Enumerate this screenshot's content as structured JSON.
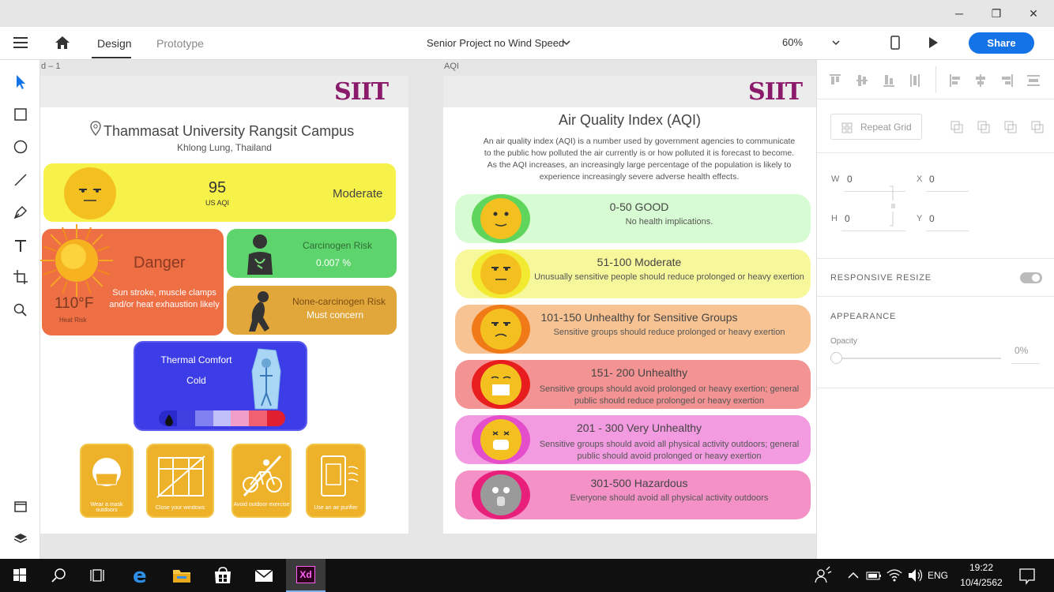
{
  "titlebar": {
    "minimize": "─",
    "restore": "❐",
    "close": "✕"
  },
  "toolbar": {
    "tabs": [
      {
        "label": "Design"
      },
      {
        "label": "Prototype"
      }
    ],
    "document_title": "Senior Project no Wind Speed",
    "zoom": "60%",
    "share_label": "Share"
  },
  "canvas": {
    "artboard1": {
      "label": "d – 1",
      "logo": "SIIT",
      "location_title": "Thammasat University Rangsit Campus",
      "location_sub": "Khlong Lung, Thailand",
      "aqi_value": "95",
      "aqi_unit": "US AQI",
      "aqi_status": "Moderate",
      "heat_title": "Danger",
      "heat_desc": "Sun stroke, muscle clamps and/or heat exhaustion likely",
      "heat_value": "110°F",
      "heat_label": "Heat Risk",
      "carcinogen_title": "Carcinogen Risk",
      "carcinogen_value": "0.007 %",
      "noncarcinogen_title": "None-carcinogen Risk",
      "noncarcinogen_value": "Must concern",
      "thermal_title": "Thermal Comfort",
      "thermal_value": "Cold",
      "tips": [
        {
          "label": "Wear a mask outdoors"
        },
        {
          "label": "Close your windows"
        },
        {
          "label": "Avoid outdoor exercise"
        },
        {
          "label": "Use an air purifier"
        }
      ]
    },
    "artboard2": {
      "label": "AQI",
      "logo": "SIIT",
      "title": "Air Quality Index (AQI)",
      "intro": "An air quality index (AQI) is a number used by government agencies to communicate to the public how polluted the air currently is or how polluted it is forecast to become. As the AQI increases, an increasingly large percentage of the population is likely to experience increasingly severe adverse health effects.",
      "levels": [
        {
          "title": "0-50 GOOD",
          "desc": "No health implications.",
          "bg": "#d7fbd3",
          "ring": "#5fd65b",
          "face": "#f3c020"
        },
        {
          "title": "51-100 Moderate",
          "desc": "Unusually sensitive people should reduce prolonged or heavy exertion",
          "bg": "#f7f79c",
          "ring": "#f2ea30",
          "face": "#f3c020"
        },
        {
          "title": "101-150 Unhealthy for Sensitive Groups",
          "desc": "Sensitive groups should reduce prolonged or heavy exertion",
          "bg": "#f8c392",
          "ring": "#f07a18",
          "face": "#f3c020"
        },
        {
          "title": "151- 200 Unhealthy",
          "desc": "Sensitive groups should avoid prolonged or heavy exertion; general public should reduce prolonged or heavy exertion",
          "bg": "#f49393",
          "ring": "#e81d1d",
          "face": "#f3c020"
        },
        {
          "title": "201 - 300 Very Unhealthy",
          "desc": "Sensitive groups should avoid all physical activity outdoors; general public should avoid prolonged or heavy exertion",
          "bg": "#f29be0",
          "ring": "#e44ecb",
          "face": "#f3c020"
        },
        {
          "title": "301-500 Hazardous",
          "desc": "Everyone should avoid all physical activity outdoors",
          "bg": "#f492c7",
          "ring": "#e8207c",
          "face": "#9a9a9a"
        }
      ]
    }
  },
  "rightpanel": {
    "repeat_grid": "Repeat Grid",
    "w_label": "W",
    "w_value": "0",
    "x_label": "X",
    "x_value": "0",
    "h_label": "H",
    "h_value": "0",
    "y_label": "Y",
    "y_value": "0",
    "responsive_resize": "RESPONSIVE RESIZE",
    "appearance": "APPEARANCE",
    "opacity_label": "Opacity",
    "opacity_value": "0%"
  },
  "taskbar": {
    "language": "ENG",
    "time": "19:22",
    "date": "10/4/2562",
    "xd_label": "Xd"
  }
}
